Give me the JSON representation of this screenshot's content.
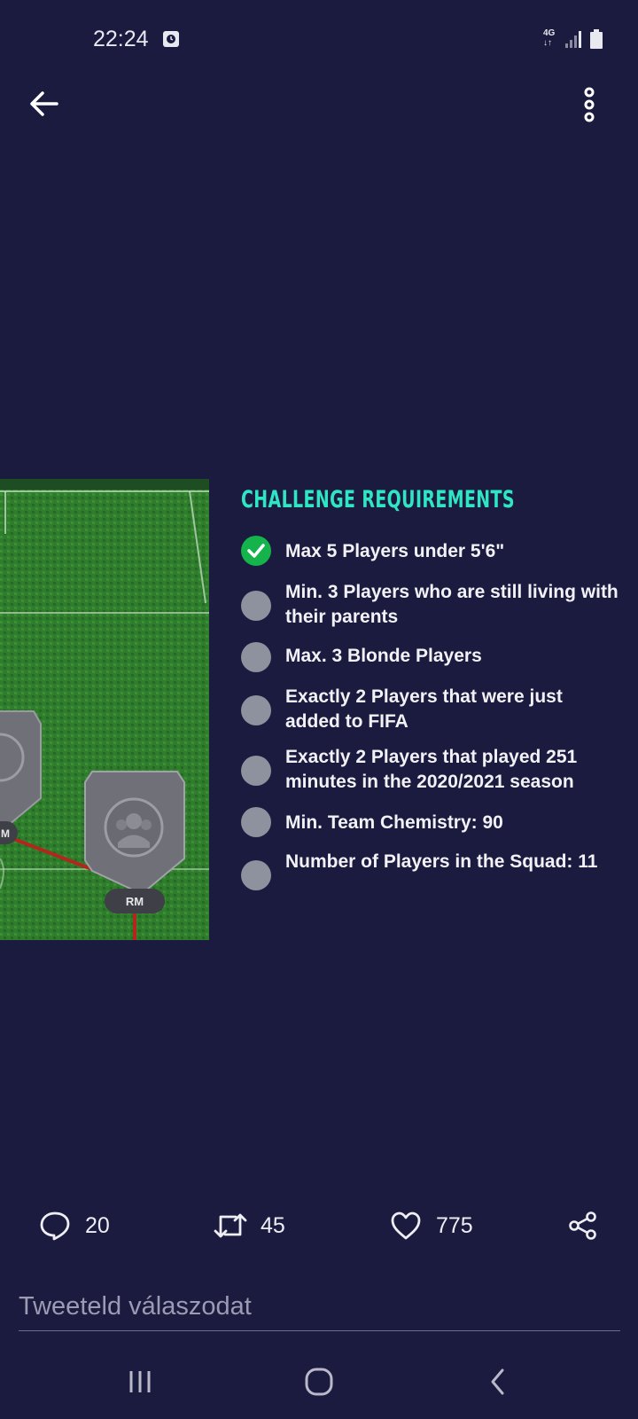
{
  "status_bar": {
    "time": "22:24",
    "network": "4G",
    "icons": [
      "alarm-icon",
      "signal-icon",
      "battery-icon"
    ]
  },
  "top_bar": {
    "back_icon": "arrow-left-icon",
    "menu_icon": "more-vertical-icon"
  },
  "media": {
    "pitch": {
      "position_labels": [
        "M",
        "RM"
      ]
    },
    "requirements": {
      "title": "CHALLENGE REQUIREMENTS",
      "items": [
        {
          "text": "Max 5 Players under 5'6\"",
          "done": true
        },
        {
          "text": "Min. 3 Players who are still living with their parents",
          "done": false
        },
        {
          "text": "Max. 3 Blonde Players",
          "done": false
        },
        {
          "text": "Exactly 2 Players that were just added to FIFA",
          "done": false
        },
        {
          "text": "Exactly 2 Players that played 251 minutes in the 2020/2021 season",
          "done": false
        },
        {
          "text": "Min. Team Chemistry: 90",
          "done": false
        },
        {
          "text": "Number of Players in the Squad: 11",
          "done": false
        }
      ]
    }
  },
  "actions": {
    "reply_count": "20",
    "retweet_count": "45",
    "like_count": "775",
    "share_icon": "share-icon"
  },
  "reply": {
    "placeholder": "Tweeteld válaszodat"
  },
  "colors": {
    "background": "#1b1a3f",
    "accent": "#2ee6c4",
    "done": "#14b34b",
    "pending": "#8e919e"
  }
}
